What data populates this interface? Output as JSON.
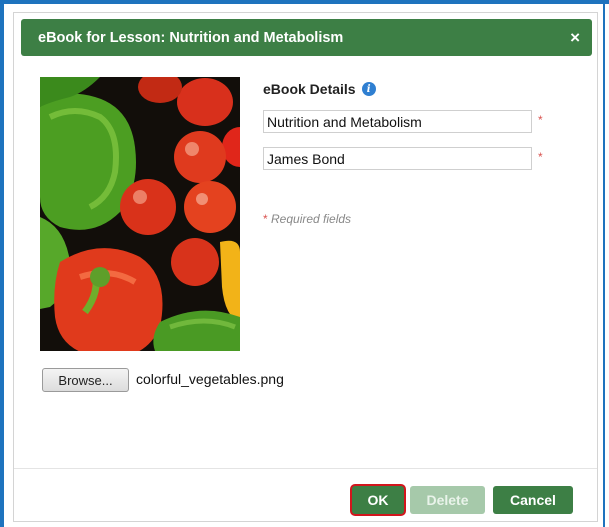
{
  "dialog": {
    "title": "eBook for Lesson: Nutrition and Metabolism",
    "close_glyph": "×"
  },
  "details": {
    "heading": "eBook Details",
    "info_glyph": "i",
    "title_value": "Nutrition and Metabolism",
    "author_value": "James Bond",
    "required_marker": "*",
    "required_note": "Required fields"
  },
  "file": {
    "browse_label": "Browse...",
    "file_name": "colorful_vegetables.png"
  },
  "buttons": {
    "ok_label": "OK",
    "delete_label": "Delete",
    "cancel_label": "Cancel"
  },
  "colors": {
    "title_bar": "#3d7f45",
    "frame_blue": "#1e73be",
    "required_red": "#d9534f"
  }
}
